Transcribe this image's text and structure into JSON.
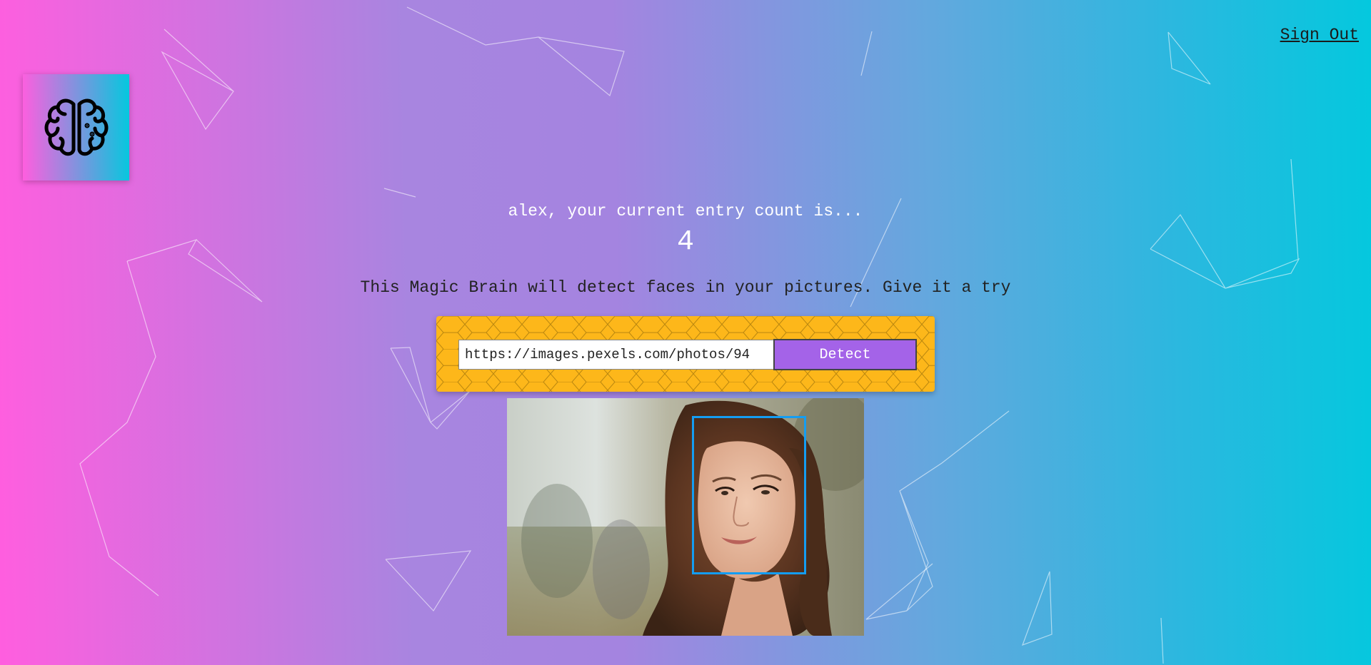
{
  "nav": {
    "signout_label": "Sign Out"
  },
  "logo": {
    "icon": "brain-icon"
  },
  "rank": {
    "message": "alex, your current entry count is...",
    "entries": "4"
  },
  "instructions": {
    "text": "This Magic Brain will detect faces in your pictures. Give it a try"
  },
  "form": {
    "url_value": "https://images.pexels.com/photos/94",
    "button_label": "Detect"
  },
  "image": {
    "subject": "photo of a smiling woman with long auburn hair",
    "detection_box_color": "#149df2"
  },
  "colors": {
    "gradient_left": "#ff5edf",
    "gradient_right": "#04c8de",
    "form_bg": "#fdb71a",
    "button_bg": "#a463e8"
  }
}
